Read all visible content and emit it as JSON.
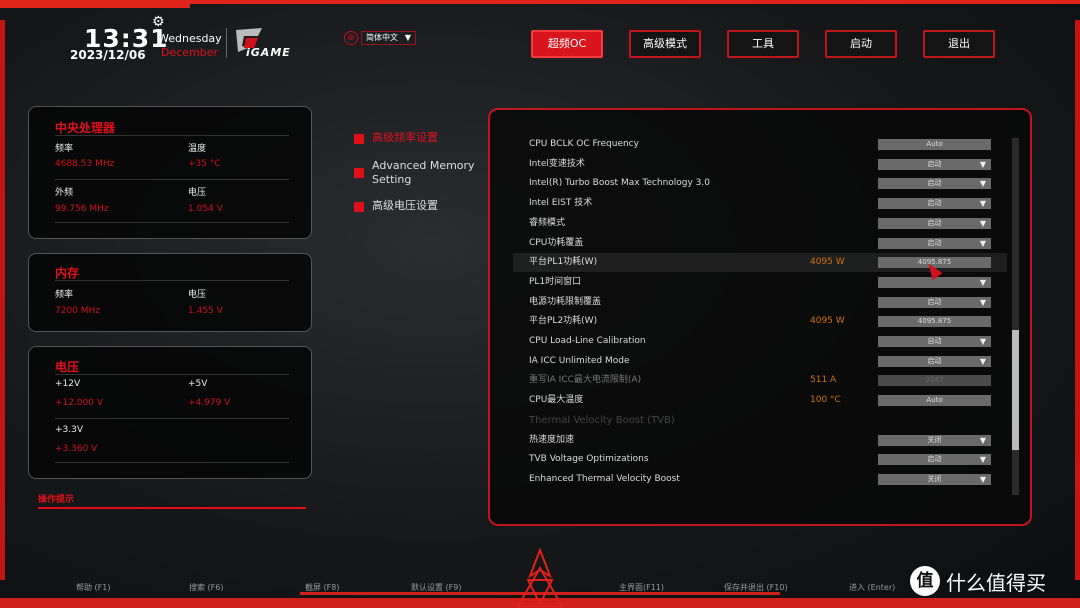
{
  "header": {
    "time": "13:31",
    "date": "2023/12/06",
    "weekday": "Wednesday",
    "month": "December",
    "brand": "iGAME",
    "language": "简体中文"
  },
  "nav": [
    {
      "label": "超频OC",
      "active": true
    },
    {
      "label": "高级模式"
    },
    {
      "label": "工具"
    },
    {
      "label": "启动"
    },
    {
      "label": "退出"
    }
  ],
  "cpu": {
    "title": "中央处理器",
    "freq_label": "频率",
    "freq": "4688.53 MHz",
    "temp_label": "温度",
    "temp": "+35 °C",
    "bclk_label": "外频",
    "bclk": "99.756 MHz",
    "volt_label": "电压",
    "volt": "1.054 V"
  },
  "memory": {
    "title": "内存",
    "freq_label": "频率",
    "freq": "7200 MHz",
    "volt_label": "电压",
    "volt": "1.455 V"
  },
  "voltage": {
    "title": "电压",
    "v12_label": "+12V",
    "v12": "+12.000 V",
    "v5_label": "+5V",
    "v5": "+4.979 V",
    "v33_label": "+3.3V",
    "v33": "+3.360 V"
  },
  "hint": "操作提示",
  "submenu": [
    {
      "label": "高级频率设置",
      "active": true
    },
    {
      "label": "Advanced Memory Setting"
    },
    {
      "label": "高级电压设置"
    }
  ],
  "settings": [
    {
      "label": "CPU BCLK OC Frequency",
      "control": "Auto",
      "dropdown": false
    },
    {
      "label": "Intel变速技术",
      "control": "启动",
      "dropdown": true
    },
    {
      "label": "Intel(R) Turbo Boost Max Technology 3.0",
      "control": "启动",
      "dropdown": true
    },
    {
      "label": "Intel EIST 技术",
      "control": "启动",
      "dropdown": true
    },
    {
      "label": "睿频模式",
      "control": "启动",
      "dropdown": true
    },
    {
      "label": "CPU功耗覆盖",
      "control": "启动",
      "dropdown": true
    },
    {
      "label": "平台PL1功耗(W)",
      "value": "4095 W",
      "control": "4095.875",
      "dropdown": false,
      "highlighted": true
    },
    {
      "label": "PL1时间窗口",
      "control": "",
      "dropdown": true
    },
    {
      "label": "电源功耗限制覆盖",
      "control": "启动",
      "dropdown": true
    },
    {
      "label": "平台PL2功耗(W)",
      "value": "4095 W",
      "control": "4095.875",
      "dropdown": false
    },
    {
      "label": "CPU Load-Line Calibration",
      "control": "自动",
      "dropdown": true
    },
    {
      "label": "IA ICC Unlimited Mode",
      "control": "启动",
      "dropdown": true
    },
    {
      "label": "重写IA ICC最大电流限制(A)",
      "value": "511 A",
      "control": "2047",
      "dropdown": false,
      "disabled": true
    },
    {
      "label": "CPU最大温度",
      "value": "100 °C",
      "control": "Auto",
      "dropdown": false
    },
    {
      "label": "Thermal Velocity Boost (TVB)",
      "section": true
    },
    {
      "label": "热速度加速",
      "control": "关闭",
      "dropdown": true
    },
    {
      "label": "TVB Voltage Optimizations",
      "control": "启动",
      "dropdown": true
    },
    {
      "label": "Enhanced Thermal Velocity Boost",
      "control": "关闭",
      "dropdown": true
    }
  ],
  "footer": [
    "帮助 (F1)",
    "搜索 (F6)",
    "截屏 (F8)",
    "默认设置 (F9)",
    "主界面(F11)",
    "保存并退出 (F10)",
    "进入 (Enter)"
  ],
  "watermark": {
    "glyph": "值",
    "text": "什么值得买"
  },
  "colors": {
    "accent": "#e0101a",
    "value_orange": "#d07010",
    "background": "#16181a"
  }
}
